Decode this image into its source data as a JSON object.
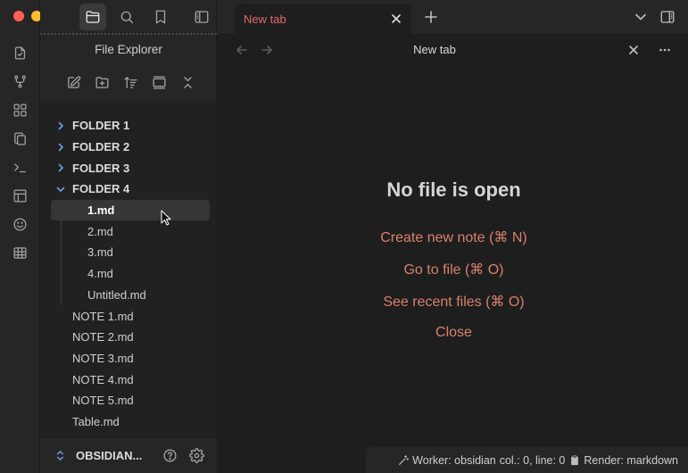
{
  "sidebar": {
    "title": "File Explorer",
    "tree": {
      "folders_closed": [
        "FOLDER 1",
        "FOLDER 2",
        "FOLDER 3"
      ],
      "folder_open": "FOLDER 4",
      "children": [
        "1.md",
        "2.md",
        "3.md",
        "4.md",
        "Untitled.md"
      ],
      "active_child": "1.md",
      "root_files": [
        "NOTE 1.md",
        "NOTE 2.md",
        "NOTE 3.md",
        "NOTE 4.md",
        "NOTE 5.md",
        "Table.md"
      ]
    },
    "vault_name": "OBSIDIAN..."
  },
  "tabs": [
    {
      "label": "New tab",
      "active": true
    }
  ],
  "view": {
    "title": "New tab",
    "empty_title": "No file is open",
    "actions": [
      "Create new note (⌘ N)",
      "Go to file (⌘ O)",
      "See recent files (⌘ O)",
      "Close"
    ]
  },
  "status": {
    "worker": "Worker: obsidian",
    "position": "col.: 0, line: 0",
    "render": "Render: markdown"
  },
  "colors": {
    "accent_link": "#d9826c",
    "tab_label": "#e36a6a",
    "chevron": "#6aa0e6"
  }
}
